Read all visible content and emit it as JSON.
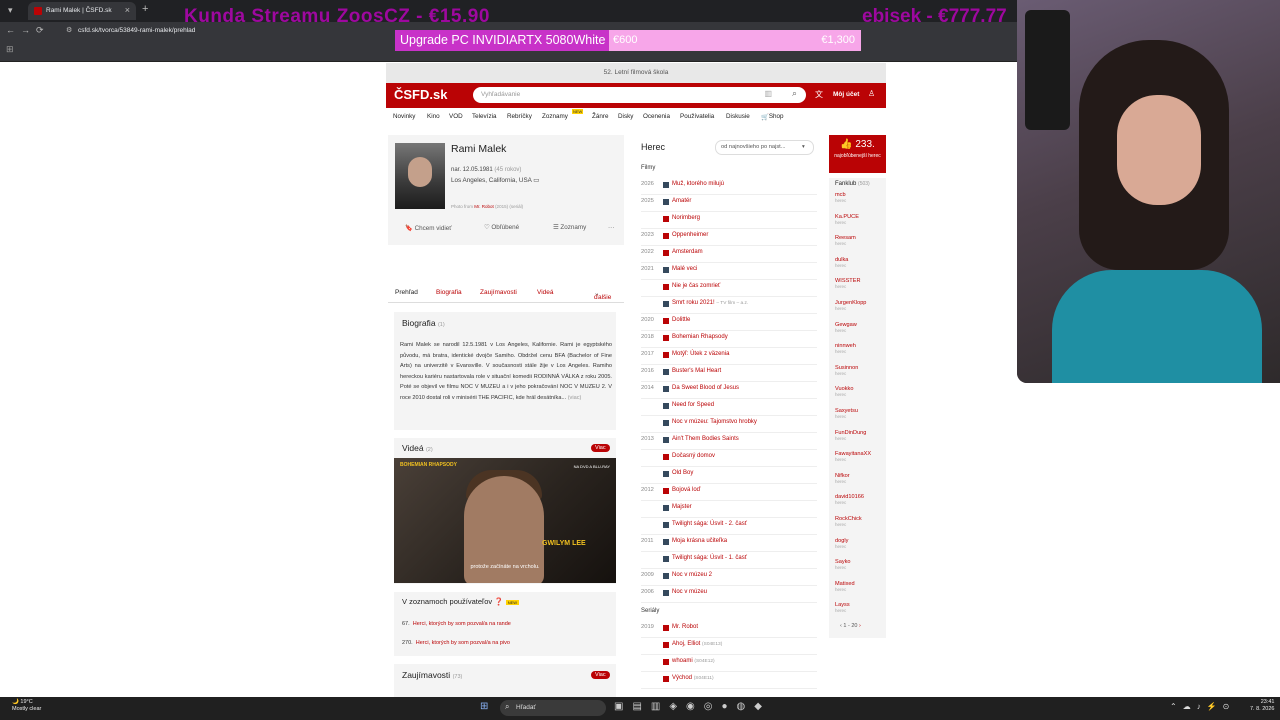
{
  "browser": {
    "tab_title": "Rami Malek | ČSFD.sk",
    "url": "csfd.sk/tvorca/53849-rami-malek/prehlad"
  },
  "overlay": {
    "left": "Kunda Streamu ZoosCZ - €15.90",
    "right": "ebisek - €777.77",
    "goal_title": "Upgrade PC INVIDIARTX 5080White",
    "goal_amount": "€600",
    "goal_target": "€1,300",
    "goal_progress": 0.46
  },
  "site": {
    "banner": "52. Letní filmová škola",
    "logo": "ČSFD.sk",
    "search_placeholder": "Vyhľadávanie",
    "account": "Môj účet",
    "menu": [
      "Novinky",
      "Kino",
      "VOD",
      "Televízia",
      "Rebríčky",
      "Zoznamy",
      "Žánre",
      "Disky",
      "Ocenenia",
      "Používatelia",
      "Diskusie",
      "Shop"
    ],
    "menu_new_badge": "NEW"
  },
  "profile": {
    "name": "Rami Malek",
    "born": "nar. 12.05.1981",
    "age": "(45 rokov)",
    "place": "Los Angeles, California, USA",
    "photo_from_label": "Photo from",
    "photo_from_title": "Mr. Robot",
    "photo_from_suffix": "(2015) (seriál)",
    "btn_want": "Chcem vidieť",
    "btn_fav": "Obľúbené",
    "btn_lists": "Zoznamy",
    "tabs": [
      "Prehľad",
      "Biografia",
      "Zaujímavosti",
      "Videá",
      "ďalšie"
    ]
  },
  "bio": {
    "title": "Biografia",
    "count": "(1)",
    "text": "Rami Malek se narodil 12.5.1981 v Los Angeles, Kalifornie. Rami je egyptského původu, má bratra, identické dvojče Samiho. Obdržel cenu BFA (Bachelor of Fine Arts) na univerzitě v Evansville. V současnosti stále žije v Los Angeles. Ramiho hereckou kariéru nastartovala role v situační komedii RODINNÁ VÁLKA z roku 2005. Poté se objevil ve filmu NOC V MUZEU a i v jeho pokračování NOC V MUZEU 2. V roce 2010 dostal roli v minisérii THE PACIFIC, kde hrál desátníka...",
    "more": "(viac)"
  },
  "videos": {
    "title": "Videá",
    "count": "(2)",
    "more": "Viac",
    "thumb_logo": "BOHEMIAN RHAPSODY",
    "thumb_corner": "NA DVD A BLU-RAY",
    "thumb_name": "GWILYM LEE",
    "thumb_subtitle": "protože začínáte na vrcholu."
  },
  "user_lists": {
    "title": "V zoznamoch používateľov",
    "badge": "NEW",
    "items": [
      {
        "num": "67.",
        "text": "Herci, ktorých by som pozval/a na rande"
      },
      {
        "num": "270.",
        "text": "Herci, ktorých by som pozval/a na pivo"
      }
    ]
  },
  "trivia": {
    "title": "Zaujímavosti",
    "count": "(73)",
    "more": "Viac"
  },
  "filmography": {
    "role": "Herec",
    "sort": "od najnovšieho po najst...",
    "films_label": "Filmy",
    "series_label": "Seriály",
    "films": [
      {
        "year": "2026",
        "title": "Muž, ktorého milujú",
        "color": "#35495d",
        "extra": ""
      },
      {
        "year": "2025",
        "title": "Amatér",
        "color": "#35495d",
        "extra": ""
      },
      {
        "year": "",
        "title": "Norimberg",
        "color": "#ba0305",
        "extra": ""
      },
      {
        "year": "2023",
        "title": "Oppenheimer",
        "color": "#ba0305",
        "extra": ""
      },
      {
        "year": "2022",
        "title": "Amsterdam",
        "color": "#ba0305",
        "extra": ""
      },
      {
        "year": "2021",
        "title": "Malé veci",
        "color": "#35495d",
        "extra": ""
      },
      {
        "year": "",
        "title": "Nie je čas zomrieť",
        "color": "#ba0305",
        "extra": ""
      },
      {
        "year": "",
        "title": "Smrt roku 2021!",
        "color": "#35495d",
        "extra": "– TV film – a.z."
      },
      {
        "year": "2020",
        "title": "Dolittle",
        "color": "#ba0305",
        "extra": ""
      },
      {
        "year": "2018",
        "title": "Bohemian Rhapsody",
        "color": "#ba0305",
        "extra": ""
      },
      {
        "year": "2017",
        "title": "Motýľ: Útek z väzenia",
        "color": "#ba0305",
        "extra": ""
      },
      {
        "year": "2016",
        "title": "Buster's Mal Heart",
        "color": "#35495d",
        "extra": ""
      },
      {
        "year": "2014",
        "title": "Da Sweet Blood of Jesus",
        "color": "#35495d",
        "extra": ""
      },
      {
        "year": "",
        "title": "Need for Speed",
        "color": "#35495d",
        "extra": ""
      },
      {
        "year": "",
        "title": "Noc v múzeu: Tajomstvo hrobky",
        "color": "#35495d",
        "extra": ""
      },
      {
        "year": "2013",
        "title": "Ain't Them Bodies Saints",
        "color": "#35495d",
        "extra": ""
      },
      {
        "year": "",
        "title": "Dočasný domov",
        "color": "#ba0305",
        "extra": ""
      },
      {
        "year": "",
        "title": "Old Boy",
        "color": "#35495d",
        "extra": ""
      },
      {
        "year": "2012",
        "title": "Bojová loď",
        "color": "#ba0305",
        "extra": ""
      },
      {
        "year": "",
        "title": "Majster",
        "color": "#35495d",
        "extra": ""
      },
      {
        "year": "",
        "title": "Twilight sága: Úsvit - 2. časť",
        "color": "#35495d",
        "extra": ""
      },
      {
        "year": "2011",
        "title": "Moja krásna učiteľka",
        "color": "#35495d",
        "extra": ""
      },
      {
        "year": "",
        "title": "Twilight sága: Úsvit - 1. časť",
        "color": "#35495d",
        "extra": ""
      },
      {
        "year": "2009",
        "title": "Noc v múzeu 2",
        "color": "#35495d",
        "extra": ""
      },
      {
        "year": "2006",
        "title": "Noc v múzeu",
        "color": "#35495d",
        "extra": ""
      }
    ],
    "series": [
      {
        "year": "2019",
        "title": "Mr. Robot",
        "color": "#ba0305",
        "extra": ""
      },
      {
        "year": "",
        "title": "Ahoj, Elliot",
        "color": "#ba0305",
        "extra": "(S04E13)"
      },
      {
        "year": "",
        "title": "whoami",
        "color": "#ba0305",
        "extra": "(S04E12)"
      },
      {
        "year": "",
        "title": "Východ",
        "color": "#ba0305",
        "extra": "(S04E11)"
      }
    ]
  },
  "fanclub": {
    "rank": "233.",
    "rank_label": "najobľúbenejší herec",
    "title": "Fanklub",
    "count": "(503)",
    "role": "herec",
    "members": [
      "mcb",
      "Ka.PUCE",
      "Reesam",
      "dulka",
      "WISSTER",
      "JurgenKlopp",
      "Gewgaw",
      "ninnweh",
      "Susinnon",
      "Vuokko",
      "Saxyetsu",
      "FunDinDung",
      "FawayitanaXX",
      "Nifkor",
      "david10166",
      "RockChick",
      "dogly",
      "Sayko",
      "Matixed",
      "Layss"
    ],
    "pager": "1 - 20"
  },
  "taskbar": {
    "temp": "19°C",
    "weather": "Mostly clear",
    "search": "Hľadať",
    "time": "23:41",
    "date": "7. 8. 2026"
  }
}
